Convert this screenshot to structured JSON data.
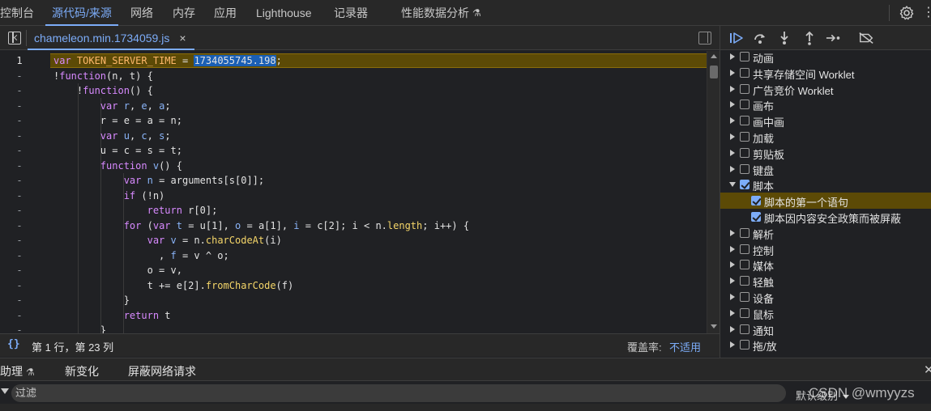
{
  "top_tabs": [
    {
      "label": "控制台"
    },
    {
      "label": "源代码/来源",
      "active": true
    },
    {
      "label": "网络"
    },
    {
      "label": "内存"
    },
    {
      "label": "应用"
    },
    {
      "label": "Lighthouse"
    },
    {
      "label": "记录器"
    },
    {
      "label": "性能数据分析"
    }
  ],
  "file_tab": {
    "name": "chameleon.min.1734059.js",
    "close": "×"
  },
  "gutter": [
    "1",
    "-",
    "-",
    "-",
    "-",
    "-",
    "-",
    "-",
    "-",
    "-",
    "-",
    "-",
    "-",
    "-",
    "-",
    "-",
    "-",
    "-",
    "-"
  ],
  "status": {
    "braces": "{}",
    "cursor": "第 1 行，第 23 列",
    "coverage_label": "覆盖率:",
    "coverage_value": "不适用"
  },
  "breakpoints": [
    {
      "label": "动画",
      "expanded": false,
      "checked": false
    },
    {
      "label": "共享存储空间 Worklet",
      "expanded": false,
      "checked": false
    },
    {
      "label": "广告竞价 Worklet",
      "expanded": false,
      "checked": false
    },
    {
      "label": "画布",
      "expanded": false,
      "checked": false
    },
    {
      "label": "画中画",
      "expanded": false,
      "checked": false
    },
    {
      "label": "加载",
      "expanded": false,
      "checked": false
    },
    {
      "label": "剪贴板",
      "expanded": false,
      "checked": false
    },
    {
      "label": "键盘",
      "expanded": false,
      "checked": false
    },
    {
      "label": "脚本",
      "expanded": true,
      "checked": true
    },
    {
      "label": "脚本的第一个语句",
      "child": true,
      "checked": true,
      "selected": true
    },
    {
      "label": "脚本因内容安全政策而被屏蔽",
      "child": true,
      "checked": true
    },
    {
      "label": "解析",
      "expanded": false,
      "checked": false
    },
    {
      "label": "控制",
      "expanded": false,
      "checked": false
    },
    {
      "label": "媒体",
      "expanded": false,
      "checked": false
    },
    {
      "label": "轻触",
      "expanded": false,
      "checked": false
    },
    {
      "label": "设备",
      "expanded": false,
      "checked": false
    },
    {
      "label": "鼠标",
      "expanded": false,
      "checked": false
    },
    {
      "label": "通知",
      "expanded": false,
      "checked": false
    },
    {
      "label": "拖/放",
      "expanded": false,
      "checked": false
    }
  ],
  "drawer_tabs": [
    {
      "label": "助理"
    },
    {
      "label": "新变化"
    },
    {
      "label": "屏蔽网络请求"
    }
  ],
  "filter": {
    "placeholder": "过滤",
    "level": "默认级别"
  },
  "watermark": "CSDN @wmyyzs",
  "colors": {
    "accent": "#7cacf8",
    "highlight": "#5c4a06",
    "background": "#202124"
  }
}
